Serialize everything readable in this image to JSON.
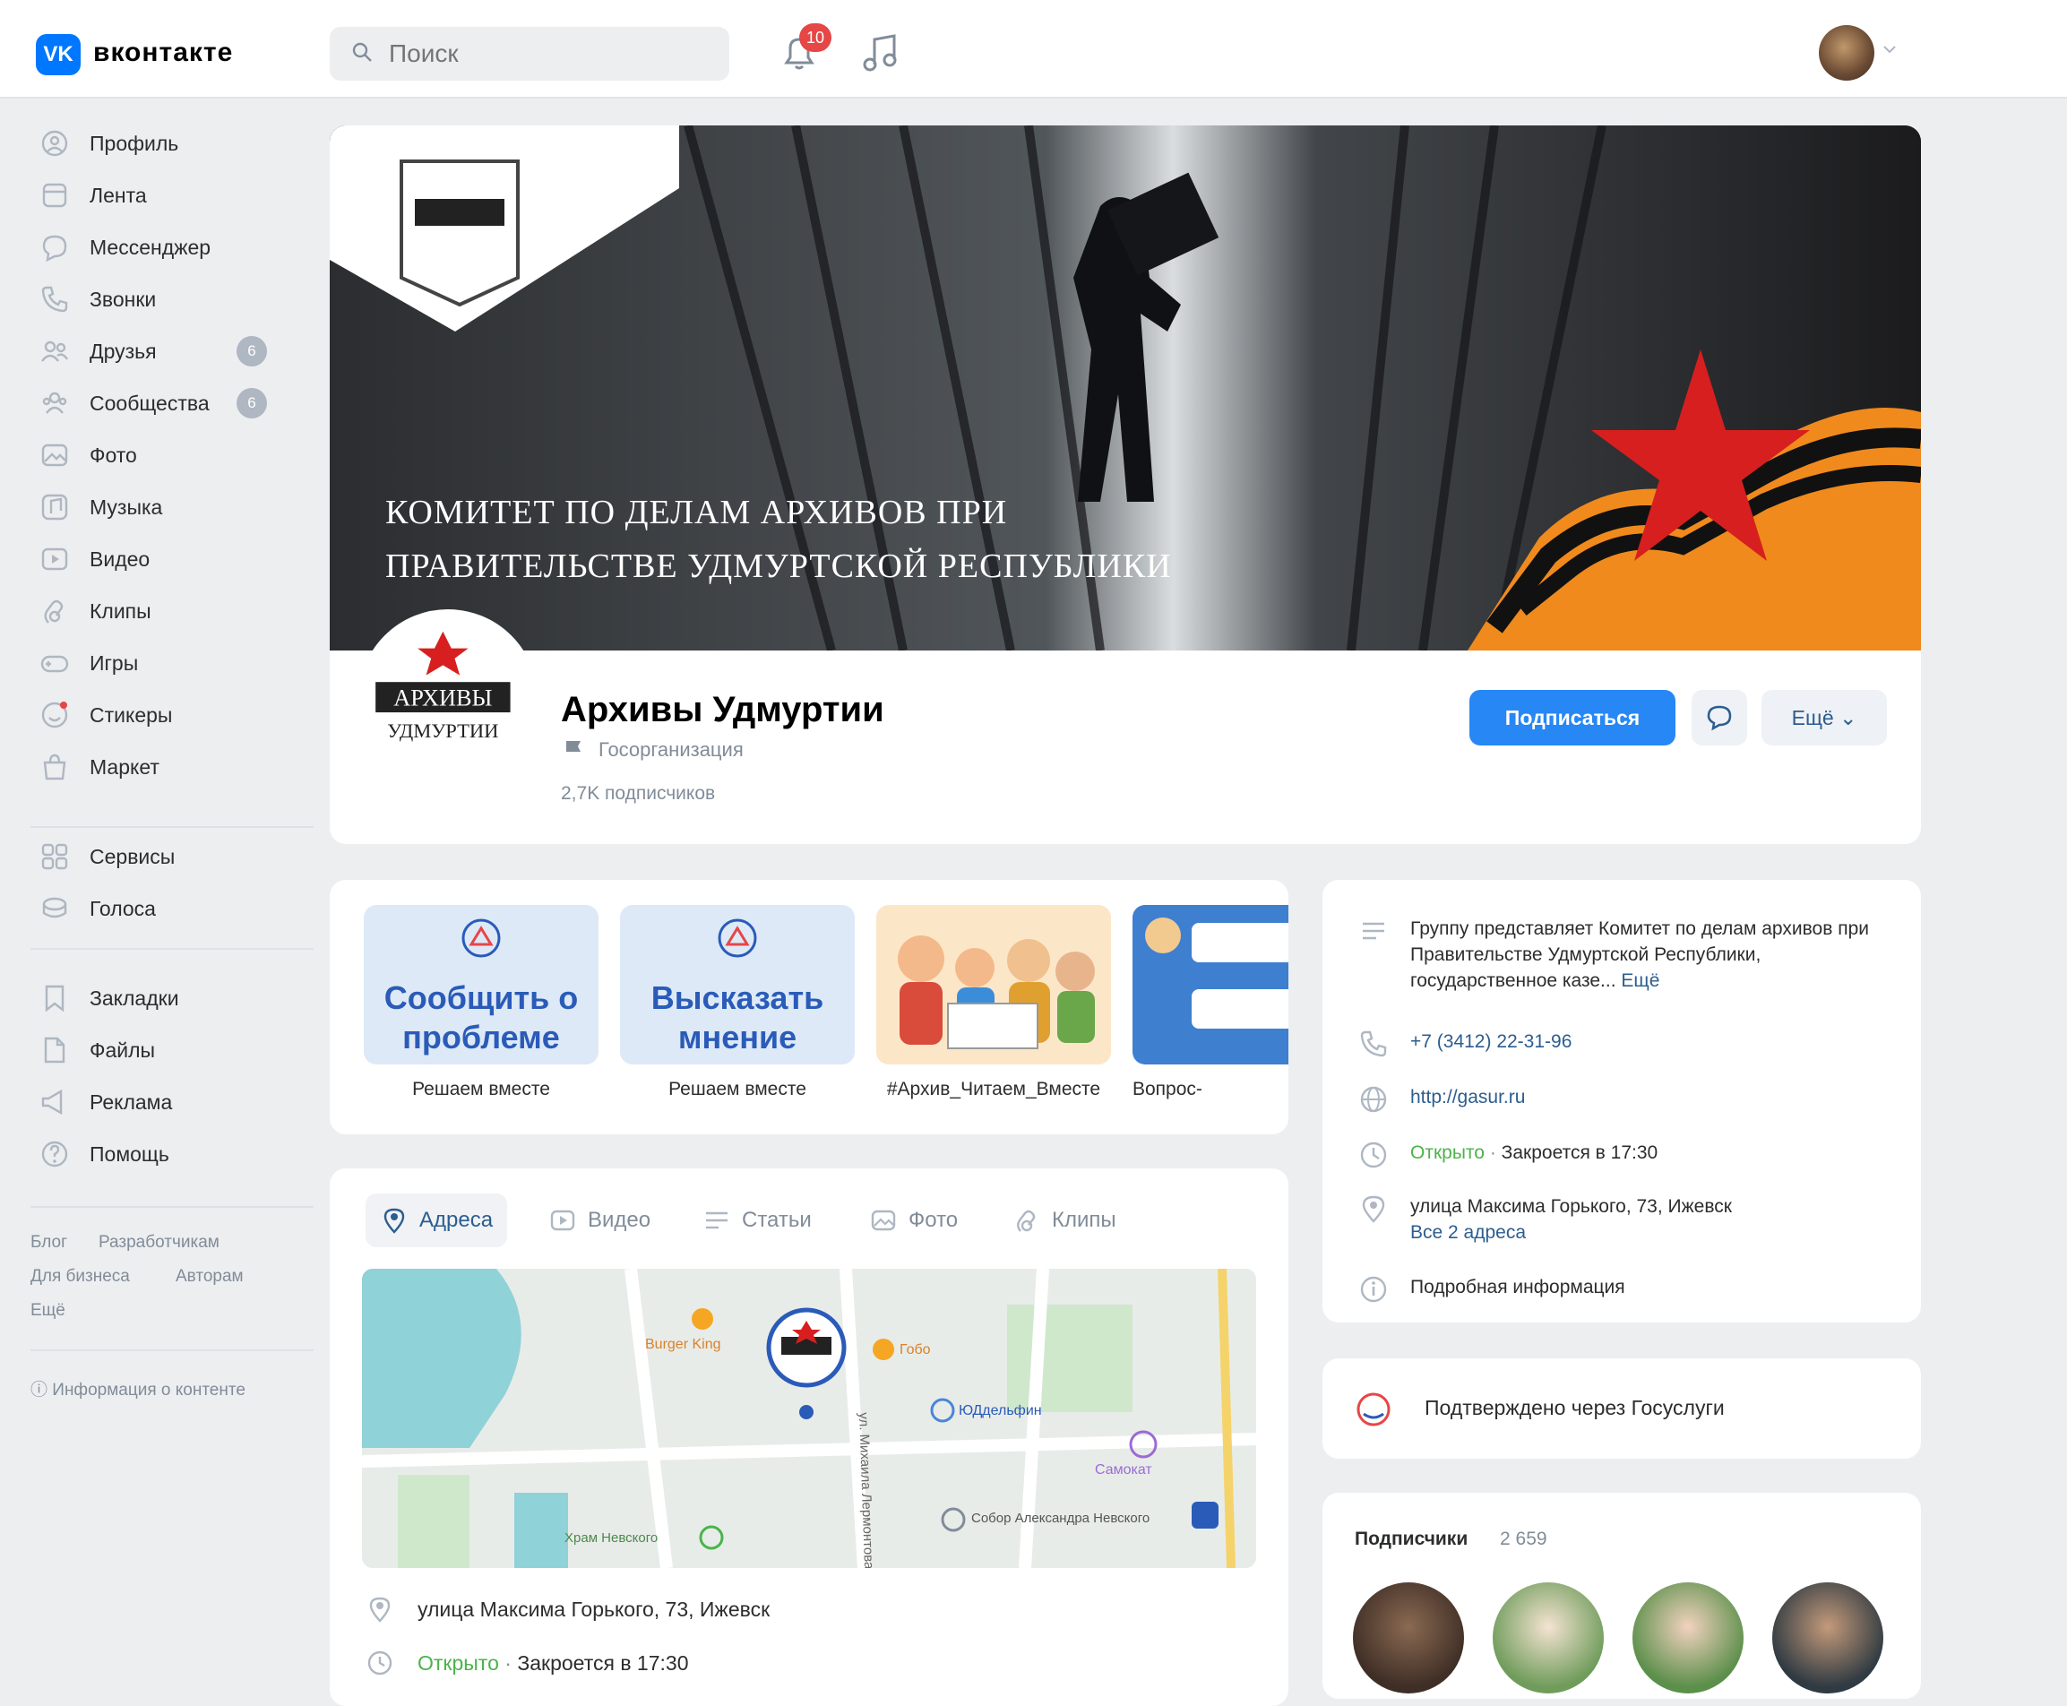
{
  "header": {
    "logo_mark": "VK",
    "logo_text": "вконтакте",
    "search_placeholder": "Поиск",
    "notifications_badge": "10",
    "colors": {
      "accent": "#0077ff",
      "badge": "#e64646",
      "button": "#2787f5"
    }
  },
  "sidebar": {
    "items": [
      {
        "label": "Профиль",
        "icon": "profile-icon"
      },
      {
        "label": "Лента",
        "icon": "feed-icon"
      },
      {
        "label": "Мессенджер",
        "icon": "messenger-icon"
      },
      {
        "label": "Звонки",
        "icon": "phone-icon"
      },
      {
        "label": "Друзья",
        "icon": "friends-icon",
        "badge": "6"
      },
      {
        "label": "Сообщества",
        "icon": "communities-icon",
        "badge": "6"
      },
      {
        "label": "Фото",
        "icon": "photo-icon"
      },
      {
        "label": "Музыка",
        "icon": "music-icon"
      },
      {
        "label": "Видео",
        "icon": "video-icon"
      },
      {
        "label": "Клипы",
        "icon": "clips-icon"
      },
      {
        "label": "Игры",
        "icon": "games-icon"
      },
      {
        "label": "Стикеры",
        "icon": "stickers-icon"
      },
      {
        "label": "Маркет",
        "icon": "market-icon"
      },
      {
        "label": "Сервисы",
        "icon": "services-icon"
      },
      {
        "label": "Голоса",
        "icon": "votes-icon"
      },
      {
        "label": "Закладки",
        "icon": "bookmarks-icon"
      },
      {
        "label": "Файлы",
        "icon": "files-icon"
      },
      {
        "label": "Реклама",
        "icon": "ads-icon"
      },
      {
        "label": "Помощь",
        "icon": "help-icon"
      }
    ],
    "footer": {
      "blog": "Блог",
      "developers": "Разработчикам",
      "business": "Для бизнеса",
      "authors": "Авторам",
      "more": "Ещё",
      "content_info": "Информация о контенте"
    }
  },
  "cover": {
    "line1": "КОМИТЕТ ПО ДЕЛАМ АРХИВОВ ПРИ",
    "line2": "ПРАВИТЕЛЬСТВЕ УДМУРТСКОЙ РЕСПУБЛИКИ",
    "emblem_top": "АРХИВЫ",
    "emblem_bottom": "УДМУРТИИ"
  },
  "group": {
    "name": "Архивы Удмуртии",
    "type": "Госорганизация",
    "subscribers": "2,7K подписчиков",
    "subscribe_label": "Подписаться",
    "more_label": "Ещё"
  },
  "widgets": [
    {
      "big": "Сообщить о проблеме",
      "caption": "Решаем вместе"
    },
    {
      "big": "Высказать мнение",
      "caption": "Решаем вместе"
    },
    {
      "caption": "#Архив_Читаем_Вместе"
    },
    {
      "caption": "Вопрос-"
    }
  ],
  "info": {
    "description": "Группу представляет Комитет по делам архивов при Правительстве Удмуртской Республики, государственное казе...",
    "description_more": "Ещё",
    "phone": "+7 (3412) 22-31-96",
    "site": "http://gasur.ru",
    "open": "Открыто",
    "closes": "Закроется в 17:30",
    "address": "улица Максима Горького, 73, Ижевск",
    "all_addresses": "Все 2 адреса",
    "details": "Подробная информация",
    "gosuslugi": "Подтверждено через Госуслуги",
    "subs_title": "Подписчики",
    "subs_count": "2 659"
  },
  "tabs": [
    {
      "label": "Адреса",
      "icon": "pin-icon"
    },
    {
      "label": "Видео",
      "icon": "video-icon"
    },
    {
      "label": "Статьи",
      "icon": "articles-icon"
    },
    {
      "label": "Фото",
      "icon": "photo-icon"
    },
    {
      "label": "Клипы",
      "icon": "clips-icon"
    }
  ],
  "map": {
    "poi1": "Burger King",
    "poi2": "Гобо",
    "poi3": "ЮДдельфин",
    "poi4": "Самокат",
    "street": "ул. Михаила Лермонтова",
    "poi5": "Собор Александра Невского",
    "poi6": "Храм Невского"
  },
  "address_rows": {
    "address": "улица Максима Горького, 73, Ижевск",
    "open": "Открыто",
    "closes": "Закроется в 17:30"
  }
}
